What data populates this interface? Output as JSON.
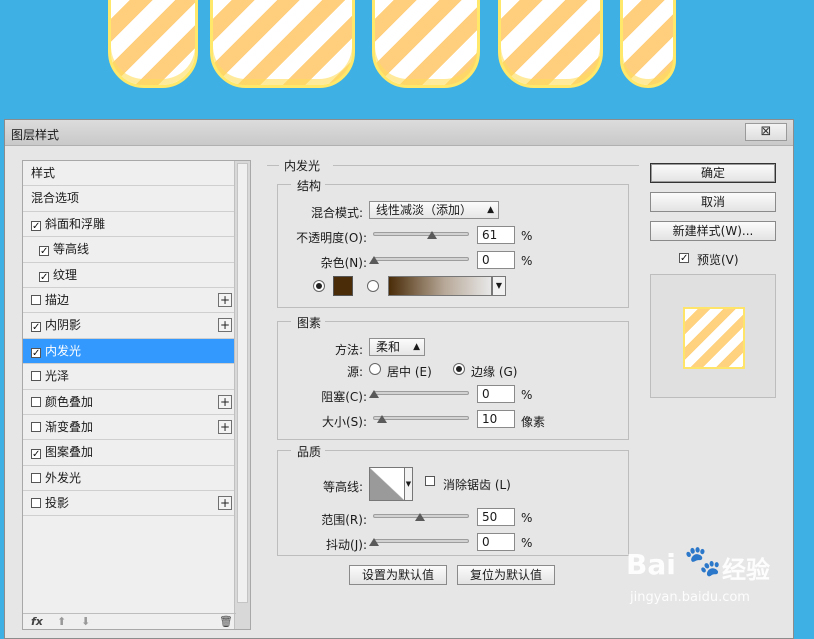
{
  "dialog": {
    "title": "图层样式",
    "close_glyph": "⊠"
  },
  "styles": {
    "header": "样式",
    "items": [
      {
        "label": "混合选项",
        "checkbox": false,
        "checked": false,
        "sub": false,
        "plus": false,
        "selected": false
      },
      {
        "label": "斜面和浮雕",
        "checkbox": true,
        "checked": true,
        "sub": false,
        "plus": false,
        "selected": false
      },
      {
        "label": "等高线",
        "checkbox": true,
        "checked": true,
        "sub": true,
        "plus": false,
        "selected": false
      },
      {
        "label": "纹理",
        "checkbox": true,
        "checked": true,
        "sub": true,
        "plus": false,
        "selected": false
      },
      {
        "label": "描边",
        "checkbox": true,
        "checked": false,
        "sub": false,
        "plus": true,
        "selected": false
      },
      {
        "label": "内阴影",
        "checkbox": true,
        "checked": true,
        "sub": false,
        "plus": true,
        "selected": false
      },
      {
        "label": "内发光",
        "checkbox": true,
        "checked": true,
        "sub": false,
        "plus": false,
        "selected": true
      },
      {
        "label": "光泽",
        "checkbox": true,
        "checked": false,
        "sub": false,
        "plus": false,
        "selected": false
      },
      {
        "label": "颜色叠加",
        "checkbox": true,
        "checked": false,
        "sub": false,
        "plus": true,
        "selected": false
      },
      {
        "label": "渐变叠加",
        "checkbox": true,
        "checked": false,
        "sub": false,
        "plus": true,
        "selected": false
      },
      {
        "label": "图案叠加",
        "checkbox": true,
        "checked": true,
        "sub": false,
        "plus": false,
        "selected": false
      },
      {
        "label": "外发光",
        "checkbox": true,
        "checked": false,
        "sub": false,
        "plus": false,
        "selected": false
      },
      {
        "label": "投影",
        "checkbox": true,
        "checked": false,
        "sub": false,
        "plus": true,
        "selected": false
      }
    ],
    "footer_fx": "fx",
    "footer_up": "⬆",
    "footer_down": "⬇",
    "footer_trash": "🗑"
  },
  "panel": {
    "title": "内发光",
    "structure": {
      "title": "结构",
      "blend_label": "混合模式:",
      "blend_value": "线性减淡（添加）",
      "opacity_label": "不透明度(O):",
      "opacity_value": "61",
      "opacity_unit": "%",
      "noise_label": "杂色(N):",
      "noise_value": "0",
      "noise_unit": "%",
      "glow_color": "#4a2c08"
    },
    "elements": {
      "title": "图素",
      "method_label": "方法:",
      "method_value": "柔和",
      "source_label": "源:",
      "source_center": "居中 (E)",
      "source_edge": "边缘 (G)",
      "choke_label": "阻塞(C):",
      "choke_value": "0",
      "choke_unit": "%",
      "size_label": "大小(S):",
      "size_value": "10",
      "size_unit": "像素"
    },
    "quality": {
      "title": "品质",
      "contour_label": "等高线:",
      "antialias_label": "消除锯齿 (L)",
      "range_label": "范围(R):",
      "range_value": "50",
      "range_unit": "%",
      "jitter_label": "抖动(J):",
      "jitter_value": "0",
      "jitter_unit": "%"
    },
    "make_default": "设置为默认值",
    "reset_default": "复位为默认值"
  },
  "actions": {
    "ok": "确定",
    "cancel": "取消",
    "new_style": "新建样式(W)...",
    "preview_label": "预览(V)"
  },
  "watermark": {
    "brand": "Bai",
    "brand_suffix": "经验",
    "url": "jingyan.baidu.com"
  }
}
